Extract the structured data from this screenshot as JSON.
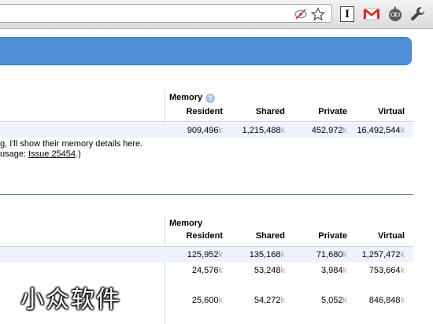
{
  "toolbar": {
    "icons": [
      "extension-blocked-icon",
      "star-icon",
      "instapaper-icon",
      "gmail-icon",
      "robot-extension-icon",
      "wrench-icon"
    ],
    "instapaper_letter": "I"
  },
  "section1": {
    "memory_label": "Memory",
    "help_glyph": "?",
    "columns": [
      "Resident",
      "Shared",
      "Private",
      "Virtual"
    ],
    "row": {
      "resident": "909,496",
      "shared": "1,215,488",
      "private": "452,972",
      "virtual": "16,492,544"
    },
    "note_line1": "g, I'll show their memory details here.",
    "note_line2_prefix": "usage: ",
    "note_link": "Issue 25454",
    "note_line2_suffix": ".)"
  },
  "section2": {
    "memory_label": "Memory",
    "columns": [
      "Resident",
      "Shared",
      "Private",
      "Virtual"
    ],
    "rows": [
      {
        "resident": "125,952",
        "shared": "135,168",
        "private": "71,680",
        "virtual": "1,257,472"
      },
      {
        "resident": "24,576",
        "shared": "53,248",
        "private": "3,984",
        "virtual": "753,664"
      },
      {
        "resident": "25,600",
        "shared": "54,272",
        "private": "5,052",
        "virtual": "846,848"
      }
    ]
  },
  "unit_suffix": "k",
  "watermark": "小众软件",
  "colors": {
    "banner": "#4f8fd6",
    "row_highlight": "#eef3fb",
    "unit": "#a8a8a8"
  }
}
